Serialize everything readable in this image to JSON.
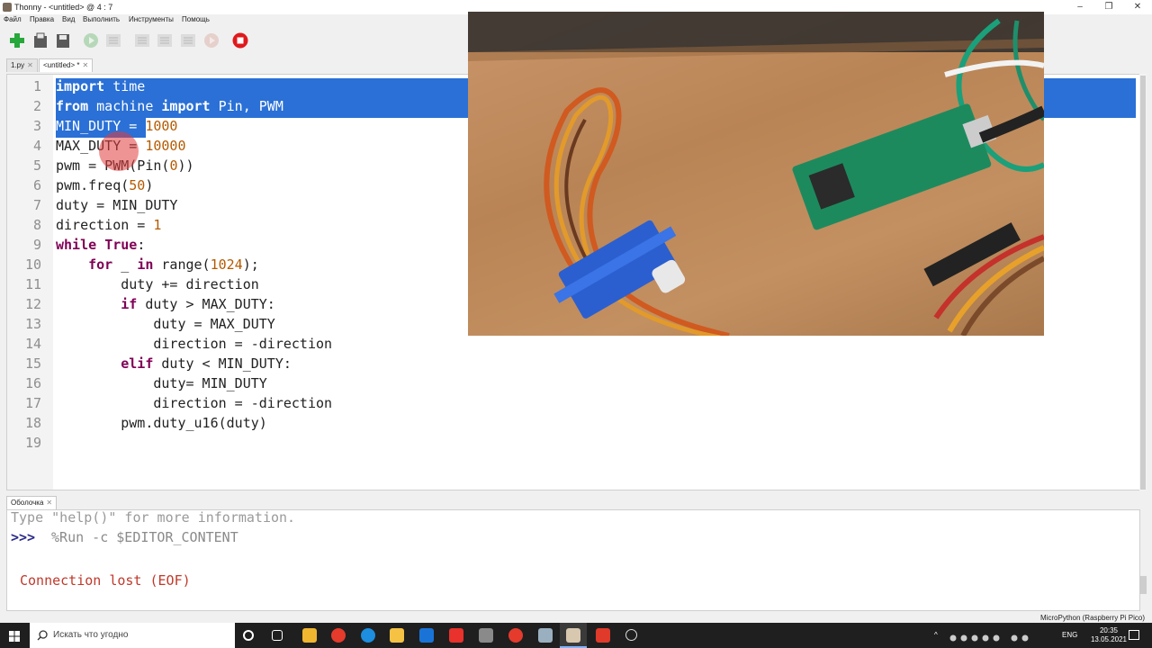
{
  "window": {
    "title": "Thonny - <untitled> @ 4 : 7",
    "controls": [
      "–",
      "❐",
      "✕"
    ]
  },
  "menu": [
    "Файл",
    "Правка",
    "Вид",
    "Выполнить",
    "Инструменты",
    "Помощь"
  ],
  "toolbar": {
    "icons": [
      "new-file-icon",
      "open-file-icon",
      "save-file-icon",
      "run-icon",
      "debug-icon",
      "step-over-icon",
      "step-into-icon",
      "step-out-icon",
      "resume-icon",
      "stop-icon"
    ]
  },
  "tabs": [
    {
      "label": "1.py",
      "close": "✕"
    },
    {
      "label": "<untitled> *",
      "close": "✕"
    }
  ],
  "editor": {
    "line_numbers": [
      "1",
      "2",
      "3",
      "4",
      "5",
      "6",
      "7",
      "8",
      "9",
      "10",
      "11",
      "12",
      "13",
      "14",
      "15",
      "16",
      "17",
      "18",
      "19"
    ],
    "selected_lines": [
      1,
      2,
      3
    ],
    "lines": [
      "import time",
      "from machine import Pin, PWM",
      "MIN_DUTY = 1000",
      "MAX_DUTY = 10000",
      "pwm = PWM(Pin(0))",
      "pwm.freq(50)",
      "duty = MIN_DUTY",
      "direction = 1",
      "while True:",
      "    for _ in range(1024);",
      "        duty += direction",
      "        if duty > MAX_DUTY:",
      "            duty = MAX_DUTY",
      "            direction = -direction",
      "        elif duty < MIN_DUTY:",
      "            duty= MIN_DUTY",
      "            direction = -direction",
      "        pwm.duty_u16(duty)",
      ""
    ]
  },
  "shell": {
    "tab_label": "Оболочка",
    "tab_close": "✕",
    "info_line": "Type \"help()\" for more information.",
    "prompt": ">>>",
    "command": " %Run -c $EDITOR_CONTENT",
    "error": "Connection lost (EOF)"
  },
  "status": {
    "interpreter": "MicroPython (Raspberry Pi Pico)"
  },
  "taskbar": {
    "search_placeholder": "Искать что угодно",
    "lang": "ENG",
    "time": "20:35",
    "date": "13.05.2021"
  },
  "colors": {
    "selection": "#2a70d6",
    "keyword": "#7f0055",
    "number": "#b45a00",
    "error": "#c0392b",
    "prompt": "#2a2a8a"
  }
}
